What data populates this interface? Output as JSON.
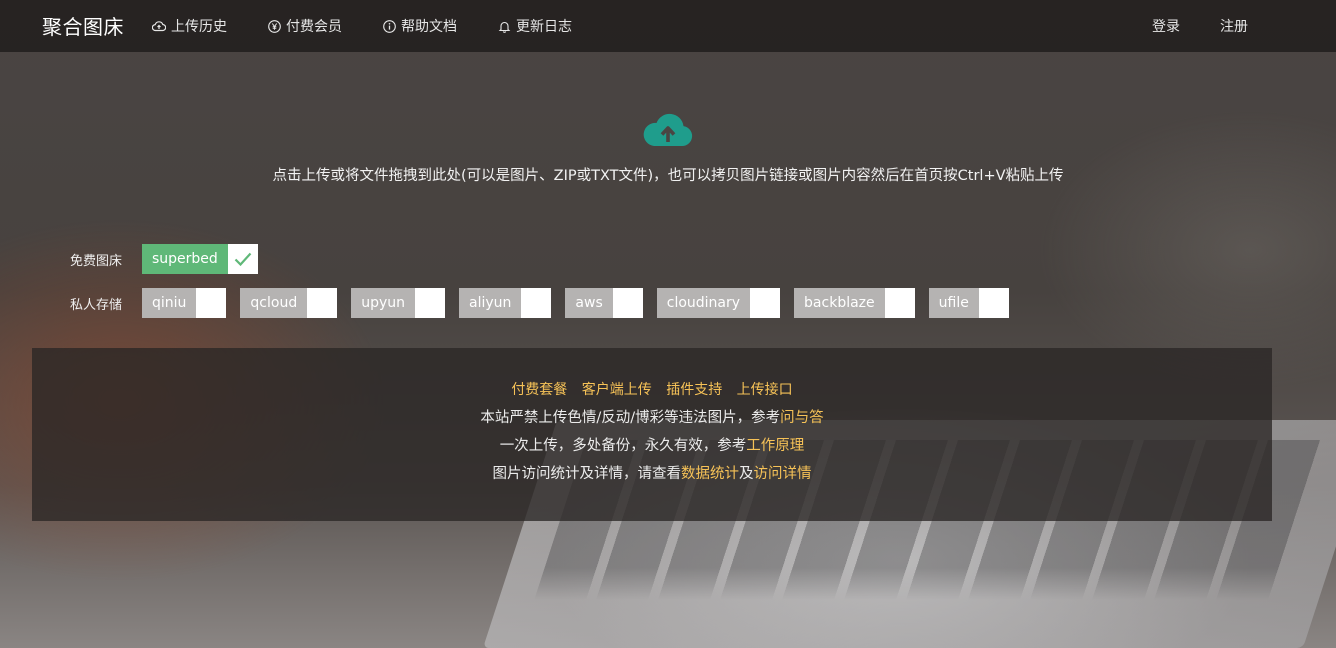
{
  "colors": {
    "accent": "#5fb878",
    "link": "#f6c257",
    "cloud": "#1f9d8c"
  },
  "brand": "聚合图床",
  "nav": {
    "left": [
      {
        "label": "上传历史",
        "icon": "cloud-upload-icon"
      },
      {
        "label": "付费会员",
        "icon": "yen-icon"
      },
      {
        "label": "帮助文档",
        "icon": "info-icon"
      },
      {
        "label": "更新日志",
        "icon": "bell-icon"
      }
    ],
    "right": [
      {
        "label": "登录"
      },
      {
        "label": "注册"
      }
    ]
  },
  "upload": {
    "icon": "cloud-upload-icon",
    "text": "点击上传或将文件拖拽到此处(可以是图片、ZIP或TXT文件)，也可以拷贝图片链接或图片内容然后在首页按Ctrl+V粘贴上传"
  },
  "free": {
    "label": "免费图床",
    "items": [
      {
        "name": "superbed",
        "checked": true
      }
    ]
  },
  "private": {
    "label": "私人存储",
    "items": [
      {
        "name": "qiniu"
      },
      {
        "name": "qcloud"
      },
      {
        "name": "upyun"
      },
      {
        "name": "aliyun"
      },
      {
        "name": "aws"
      },
      {
        "name": "cloudinary"
      },
      {
        "name": "backblaze"
      },
      {
        "name": "ufile"
      }
    ]
  },
  "info": {
    "links": [
      "付费套餐",
      "客户端上传",
      "插件支持",
      "上传接口"
    ],
    "line1": {
      "text": "本站严禁上传色情/反动/博彩等违法图片，参考",
      "link": "问与答"
    },
    "line2": {
      "text": "一次上传，多处备份，永久有效，参考",
      "link": "工作原理"
    },
    "line3": {
      "text": "图片访问统计及详情，请查看",
      "link1": "数据统计",
      "mid": "及",
      "link2": "访问详情"
    }
  }
}
